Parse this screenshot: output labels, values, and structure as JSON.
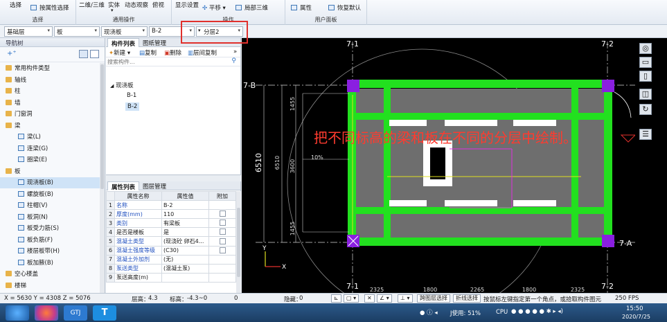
{
  "ribbon": {
    "select": "选择",
    "attr_select": "按属性选择",
    "view_2d3d": "二维/三维",
    "entity": "实体",
    "dynamic": "动态观察",
    "ortho": "俯视",
    "display_settings": "显示设置",
    "pan": "平移",
    "local3d": "局部三维",
    "attributes": "属性",
    "restore_default": "恢复默认",
    "groups": {
      "select": "选择",
      "common": "通用操作",
      "operate": "操作",
      "userpanel": "用户面板"
    }
  },
  "toolbar": {
    "floor": "基础层",
    "category": "板",
    "type": "现浇板",
    "component": "B-2",
    "sublayer": "分层2"
  },
  "nav": {
    "title": "导航树",
    "items": [
      {
        "label": "常用构件类型",
        "kind": "folder"
      },
      {
        "label": "轴线",
        "kind": "folder"
      },
      {
        "label": "柱",
        "kind": "folder"
      },
      {
        "label": "墙",
        "kind": "folder"
      },
      {
        "label": "门窗洞",
        "kind": "folder"
      },
      {
        "label": "梁",
        "kind": "folder"
      },
      {
        "label": "梁(L)",
        "kind": "sub"
      },
      {
        "label": "连梁(G)",
        "kind": "sub"
      },
      {
        "label": "圈梁(E)",
        "kind": "sub"
      },
      {
        "label": "板",
        "kind": "folder"
      },
      {
        "label": "现浇板(B)",
        "kind": "sub",
        "selected": true
      },
      {
        "label": "螺旋板(B)",
        "kind": "sub"
      },
      {
        "label": "柱帽(V)",
        "kind": "sub"
      },
      {
        "label": "板洞(N)",
        "kind": "sub"
      },
      {
        "label": "板受力筋(S)",
        "kind": "sub"
      },
      {
        "label": "板负筋(F)",
        "kind": "sub"
      },
      {
        "label": "楼层板带(H)",
        "kind": "sub"
      },
      {
        "label": "板加腋(B)",
        "kind": "sub"
      },
      {
        "label": "空心楼盖",
        "kind": "folder"
      },
      {
        "label": "楼梯",
        "kind": "folder"
      }
    ]
  },
  "component_list": {
    "tab1": "构件列表",
    "tab2": "图纸管理",
    "new": "新建",
    "copy": "复制",
    "delete": "删除",
    "floor_copy": "层间复制",
    "search_placeholder": "搜索构件...",
    "root": "现浇板",
    "children": [
      "B-1",
      "B-2"
    ]
  },
  "properties": {
    "tab1": "属性列表",
    "tab2": "图层管理",
    "headers": [
      "属性名称",
      "属性值",
      "附加"
    ],
    "rows": [
      {
        "n": "1",
        "name": "名称",
        "value": "B-2",
        "blue": true,
        "check": false
      },
      {
        "n": "2",
        "name": "厚度(mm)",
        "value": "110",
        "blue": true,
        "check": true
      },
      {
        "n": "3",
        "name": "类别",
        "value": "有梁板",
        "blue": true,
        "check": true
      },
      {
        "n": "4",
        "name": "是否是楼板",
        "value": "是",
        "blue": false,
        "check": true
      },
      {
        "n": "5",
        "name": "混凝土类型",
        "value": "(现浇砼 卵石4...",
        "blue": true,
        "check": true
      },
      {
        "n": "6",
        "name": "混凝土强度等级",
        "value": "(C30)",
        "blue": true,
        "check": true
      },
      {
        "n": "7",
        "name": "混凝土外加剂",
        "value": "(无)",
        "blue": true,
        "check": false
      },
      {
        "n": "8",
        "name": "泵送类型",
        "value": "(混凝土泵)",
        "blue": true,
        "check": false
      },
      {
        "n": "9",
        "name": "泵送高度(m)",
        "value": "",
        "blue": false,
        "check": false
      }
    ]
  },
  "canvas": {
    "overlay_text": "把不同标高的梁和板在不同的分层中绘制。",
    "axis_top_left": "7-1",
    "axis_top_right": "7-2",
    "axis_left": "7-B",
    "axis_right": "7-A",
    "axis_bottom_left": "7-1",
    "axis_bottom_right": "7-2",
    "dim_total": "6510",
    "dim_inner": "6510",
    "dim_top": "1455",
    "dim_mid": "3600",
    "dim_bottom": "1455",
    "dim_slope": "10%",
    "bottom_dims": [
      "2325",
      "1800",
      "2265",
      "1800",
      "2325"
    ],
    "ucs_y": "Y",
    "ucs_x": "X",
    "colors": {
      "beam": "#22e01f",
      "column": "#8a1fe0",
      "slab": "#6e6e6e"
    }
  },
  "status": {
    "coords": "X = 5630 Y = 4308 Z = 5076",
    "floor_height_label": "层高：",
    "floor_height": "4.3",
    "elevation_label": "标高：",
    "elevation": "-4.3~0",
    "zero": "0",
    "hidden_label": "隐藏：",
    "hidden": "0",
    "cross_layer": "跨图层选择",
    "polyline": "折线选择",
    "hint": "按鼠标左键指定第一个角点，或拾取构件图元",
    "fps": "250 FPS"
  },
  "taskbar": {
    "app_label": "GTJ",
    "cpu": "J使用: 51%",
    "cpu2": "CPU",
    "time": "15:50",
    "date": "2020/7/25"
  }
}
